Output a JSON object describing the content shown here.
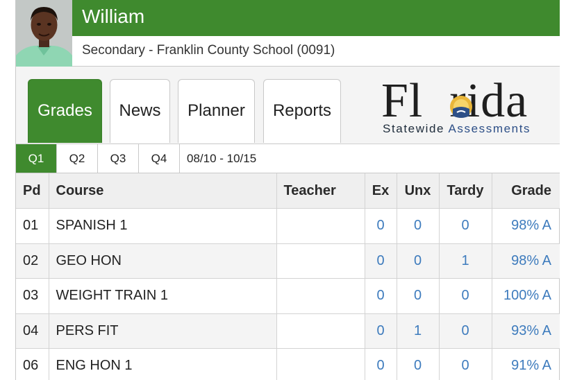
{
  "student": {
    "name": "William",
    "school": "Secondary - Franklin County School (0091)"
  },
  "tabs": [
    {
      "label": "Grades",
      "active": true
    },
    {
      "label": "News",
      "active": false
    },
    {
      "label": "Planner",
      "active": false
    },
    {
      "label": "Reports",
      "active": false
    }
  ],
  "logo": {
    "word_start": "Fl",
    "word_end": "rida",
    "sub_plain": "Statewide ",
    "sub_accent": "Assessments"
  },
  "quarters": [
    {
      "label": "Q1",
      "active": true
    },
    {
      "label": "Q2",
      "active": false
    },
    {
      "label": "Q3",
      "active": false
    },
    {
      "label": "Q4",
      "active": false
    }
  ],
  "date_range": "08/10 - 10/15",
  "table": {
    "headers": [
      "Pd",
      "Course",
      "Teacher",
      "Ex",
      "Unx",
      "Tardy",
      "Grade"
    ],
    "rows": [
      {
        "pd": "01",
        "course": "SPANISH 1",
        "teacher": "",
        "ex": "0",
        "unx": "0",
        "tardy": "0",
        "grade": "98% A"
      },
      {
        "pd": "02",
        "course": "GEO HON",
        "teacher": "",
        "ex": "0",
        "unx": "0",
        "tardy": "1",
        "grade": "98% A"
      },
      {
        "pd": "03",
        "course": "WEIGHT TRAIN 1",
        "teacher": "",
        "ex": "0",
        "unx": "0",
        "tardy": "0",
        "grade": "100% A"
      },
      {
        "pd": "04",
        "course": "PERS FIT",
        "teacher": "",
        "ex": "0",
        "unx": "1",
        "tardy": "0",
        "grade": "93% A"
      },
      {
        "pd": "06",
        "course": "ENG HON 1",
        "teacher": "",
        "ex": "0",
        "unx": "0",
        "tardy": "0",
        "grade": "91% A"
      }
    ]
  },
  "colors": {
    "accent_green": "#3f8a2e",
    "link_blue": "#3d7bbd",
    "logo_blue": "#2d4f87"
  }
}
